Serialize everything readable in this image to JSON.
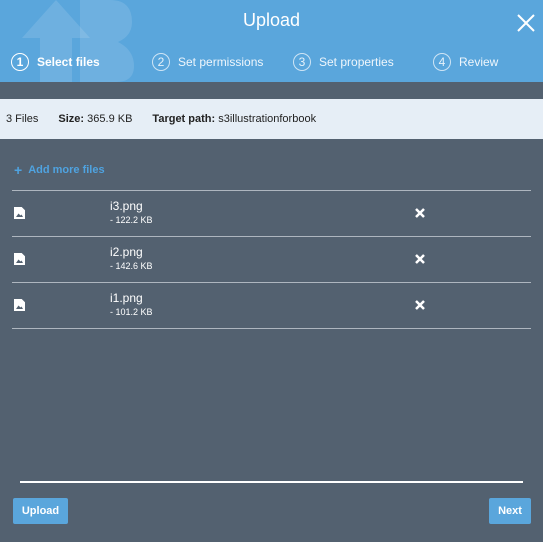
{
  "dialog": {
    "title": "Upload"
  },
  "steps": [
    {
      "number": "1",
      "label": "Select files"
    },
    {
      "number": "2",
      "label": "Set permissions"
    },
    {
      "number": "3",
      "label": "Set properties"
    },
    {
      "number": "4",
      "label": "Review"
    }
  ],
  "summary": {
    "files_count": "3 Files",
    "size_label": "Size:",
    "size_value": "365.9 KB",
    "target_label": "Target path:",
    "target_value": "s3illustrationforbook"
  },
  "add_more": {
    "label": "Add more files",
    "icon": "plus-icon"
  },
  "files": [
    {
      "name": "i3.png",
      "size": "- 122.2 KB"
    },
    {
      "name": "i2.png",
      "size": "- 142.6 KB"
    },
    {
      "name": "i1.png",
      "size": "- 101.2 KB"
    }
  ],
  "buttons": {
    "upload": "Upload",
    "next": "Next"
  },
  "colors": {
    "header": "#5aa6dc",
    "body": "#536170",
    "infobar": "#e6eef6",
    "accent": "#4fa3e0"
  }
}
